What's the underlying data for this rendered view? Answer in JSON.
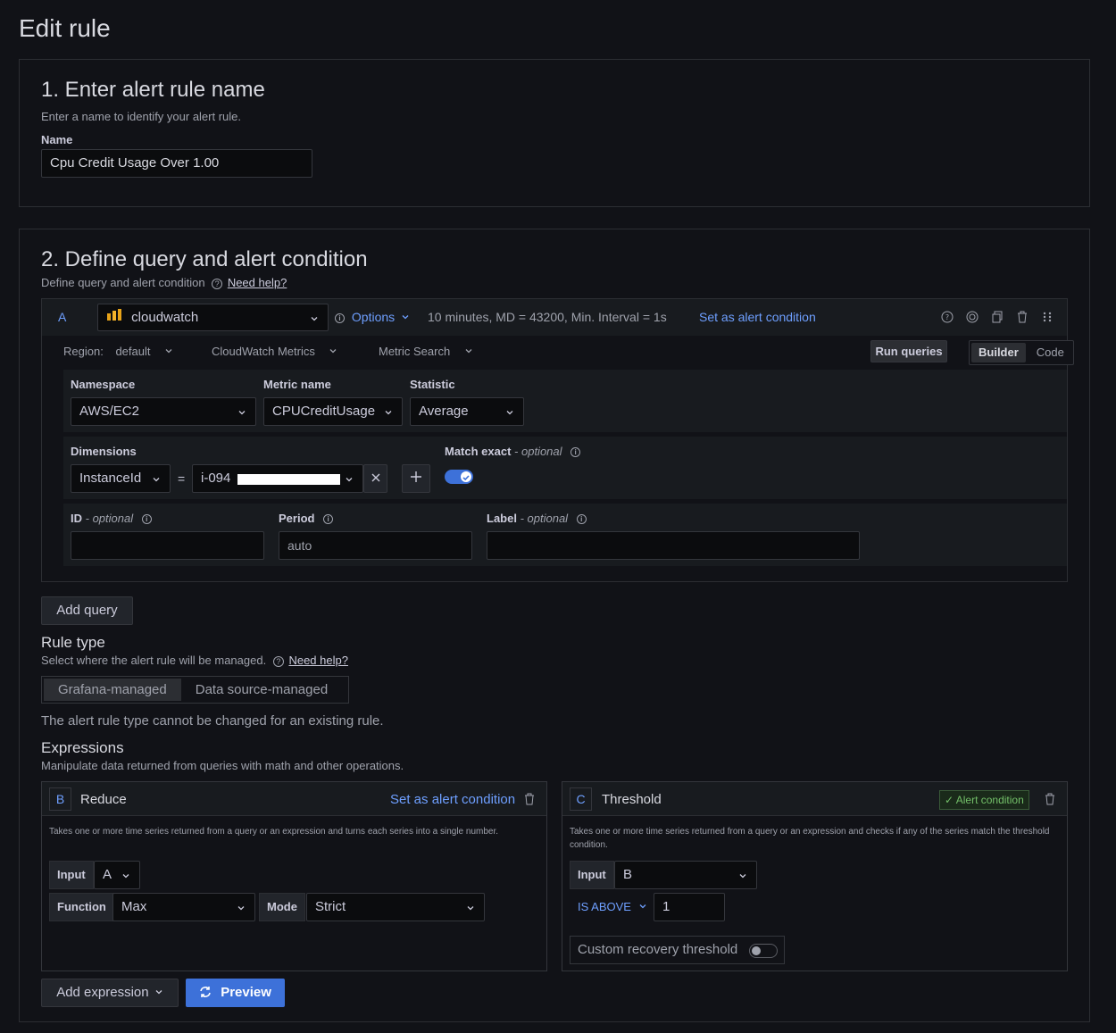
{
  "page": {
    "title": "Edit rule"
  },
  "section1": {
    "title": "1. Enter alert rule name",
    "description": "Enter a name to identify your alert rule.",
    "name_label": "Name",
    "name_value": "Cpu Credit Usage Over 1.00"
  },
  "section2": {
    "title": "2. Define query and alert condition",
    "description": "Define query and alert condition",
    "need_help": "Need help?",
    "query": {
      "ref_id": "A",
      "datasource": "cloudwatch",
      "options_label": "Options",
      "options_summary": "10 minutes, MD = 43200, Min. Interval = 1s",
      "set_alert_condition": "Set as alert condition",
      "region_label": "Region:",
      "region_value": "default",
      "metrics_mode": "CloudWatch Metrics",
      "search_mode": "Metric Search",
      "run_queries": "Run queries",
      "builder": "Builder",
      "code": "Code",
      "namespace_label": "Namespace",
      "namespace_value": "AWS/EC2",
      "metric_label": "Metric name",
      "metric_value": "CPUCreditUsage",
      "statistic_label": "Statistic",
      "statistic_value": "Average",
      "dimensions_label": "Dimensions",
      "dimension_key": "InstanceId",
      "dimension_op": "=",
      "dimension_value": "i-094",
      "match_exact_label": "Match exact",
      "match_exact_optional": "- optional",
      "match_exact_on": true,
      "id_label": "ID",
      "id_optional": "- optional",
      "period_label": "Period",
      "period_placeholder": "auto",
      "label_label": "Label",
      "label_optional": "- optional"
    },
    "add_query": "Add query",
    "rule_type": {
      "title": "Rule type",
      "description": "Select where the alert rule will be managed.",
      "need_help": "Need help?",
      "options": [
        "Grafana-managed",
        "Data source-managed"
      ],
      "selected": "Grafana-managed",
      "note": "The alert rule type cannot be changed for an existing rule."
    },
    "expressions": {
      "title": "Expressions",
      "description": "Manipulate data returned from queries with math and other operations.",
      "reduce": {
        "ref_id": "B",
        "name": "Reduce",
        "set_alert_condition": "Set as alert condition",
        "description": "Takes one or more time series returned from a query or an expression and turns each series into a single number.",
        "input_label": "Input",
        "input_value": "A",
        "function_label": "Function",
        "function_value": "Max",
        "mode_label": "Mode",
        "mode_value": "Strict"
      },
      "threshold": {
        "ref_id": "C",
        "name": "Threshold",
        "alert_condition_badge": "Alert condition",
        "description": "Takes one or more time series returned from a query or an expression and checks if any of the series match the threshold condition.",
        "input_label": "Input",
        "input_value": "B",
        "operator": "IS ABOVE",
        "value": "1",
        "custom_recovery": "Custom recovery threshold",
        "custom_recovery_on": false
      }
    },
    "add_expression": "Add expression",
    "preview": "Preview"
  },
  "colors": {
    "accent": "#6e9fff",
    "primary_button": "#3d71d9",
    "success": "#73bf69"
  }
}
